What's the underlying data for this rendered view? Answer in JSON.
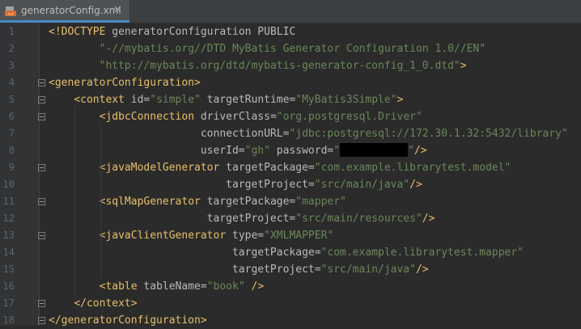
{
  "tab": {
    "title": "generatorConfig.xml",
    "close": "✕",
    "icon": "xml-file-icon"
  },
  "lines": [
    {
      "n": "1",
      "tokens": [
        {
          "c": "t",
          "s": "<!DOCTYPE "
        },
        {
          "c": "a",
          "s": "generatorConfiguration PUBLIC"
        }
      ]
    },
    {
      "n": "2",
      "tokens": [
        {
          "c": "a",
          "s": "        "
        },
        {
          "c": "v",
          "s": "\"-//mybatis.org//DTD MyBatis Generator Configuration 1.0//EN\""
        }
      ]
    },
    {
      "n": "3",
      "tokens": [
        {
          "c": "a",
          "s": "        "
        },
        {
          "c": "v",
          "s": "\"http://mybatis.org/dtd/mybatis-generator-config_1_0.dtd\""
        },
        {
          "c": "t",
          "s": ">"
        }
      ]
    },
    {
      "n": "4",
      "tokens": [
        {
          "c": "t",
          "s": "<generatorConfiguration>"
        }
      ]
    },
    {
      "n": "5",
      "tokens": [
        {
          "c": "a",
          "s": "    "
        },
        {
          "c": "t",
          "s": "<context "
        },
        {
          "c": "a",
          "s": "id="
        },
        {
          "c": "v",
          "s": "\"simple\""
        },
        {
          "c": "a",
          "s": " targetRuntime="
        },
        {
          "c": "v",
          "s": "\"MyBatis3Simple\""
        },
        {
          "c": "t",
          "s": ">"
        }
      ]
    },
    {
      "n": "6",
      "tokens": [
        {
          "c": "a",
          "s": "        "
        },
        {
          "c": "t",
          "s": "<jdbcConnection "
        },
        {
          "c": "a",
          "s": "driverClass="
        },
        {
          "c": "v",
          "s": "\"org.postgresql.Driver\""
        }
      ]
    },
    {
      "n": "7",
      "tokens": [
        {
          "c": "a",
          "s": "                        connectionURL="
        },
        {
          "c": "v",
          "s": "\"jdbc:postgresql://172.30.1.32:5432/library\""
        }
      ]
    },
    {
      "n": "8",
      "tokens": [
        {
          "c": "a",
          "s": "                        userId="
        },
        {
          "c": "v",
          "s": "\"gh\""
        },
        {
          "c": "a",
          "s": " password="
        },
        {
          "c": "v",
          "s": "\""
        },
        {
          "c": "r",
          "s": ""
        },
        {
          "c": "v",
          "s": "\""
        },
        {
          "c": "t",
          "s": "/>"
        }
      ]
    },
    {
      "n": "9",
      "tokens": [
        {
          "c": "a",
          "s": "        "
        },
        {
          "c": "t",
          "s": "<javaModelGenerator "
        },
        {
          "c": "a",
          "s": "targetPackage="
        },
        {
          "c": "v",
          "s": "\"com.example.librarytest.model\""
        }
      ]
    },
    {
      "n": "10",
      "tokens": [
        {
          "c": "a",
          "s": "                            targetProject="
        },
        {
          "c": "v",
          "s": "\"src/main/java\""
        },
        {
          "c": "t",
          "s": "/>"
        }
      ]
    },
    {
      "n": "11",
      "tokens": [
        {
          "c": "a",
          "s": "        "
        },
        {
          "c": "t",
          "s": "<sqlMapGenerator "
        },
        {
          "c": "a",
          "s": "targetPackage="
        },
        {
          "c": "v",
          "s": "\"mapper\""
        }
      ]
    },
    {
      "n": "12",
      "tokens": [
        {
          "c": "a",
          "s": "                         targetProject="
        },
        {
          "c": "v",
          "s": "\"src/main/resources\""
        },
        {
          "c": "t",
          "s": "/>"
        }
      ]
    },
    {
      "n": "13",
      "tokens": [
        {
          "c": "a",
          "s": "        "
        },
        {
          "c": "t",
          "s": "<javaClientGenerator "
        },
        {
          "c": "a",
          "s": "type="
        },
        {
          "c": "v",
          "s": "\"XMLMAPPER\""
        }
      ]
    },
    {
      "n": "14",
      "tokens": [
        {
          "c": "a",
          "s": "                             targetPackage="
        },
        {
          "c": "v",
          "s": "\"com.example.librarytest.mapper\""
        }
      ]
    },
    {
      "n": "15",
      "tokens": [
        {
          "c": "a",
          "s": "                             targetProject="
        },
        {
          "c": "v",
          "s": "\"src/main/java\""
        },
        {
          "c": "t",
          "s": "/>"
        }
      ]
    },
    {
      "n": "16",
      "tokens": [
        {
          "c": "a",
          "s": "        "
        },
        {
          "c": "t",
          "s": "<table "
        },
        {
          "c": "a",
          "s": "tableName="
        },
        {
          "c": "v",
          "s": "\"book\""
        },
        {
          "c": "a",
          "s": " "
        },
        {
          "c": "t",
          "s": "/>"
        }
      ]
    },
    {
      "n": "17",
      "tokens": [
        {
          "c": "a",
          "s": "    "
        },
        {
          "c": "t",
          "s": "</context>"
        }
      ]
    },
    {
      "n": "18",
      "tokens": [
        {
          "c": "t",
          "s": "</generatorConfiguration>"
        }
      ]
    }
  ],
  "fold_lines": [
    4,
    5,
    6,
    9,
    11,
    13,
    17,
    18
  ],
  "colors": {
    "tag": "#e8bf6a",
    "attr": "#bababa",
    "value": "#6a8759",
    "background": "#2b2b2b",
    "gutter": "#313335",
    "line_number": "#606366"
  }
}
